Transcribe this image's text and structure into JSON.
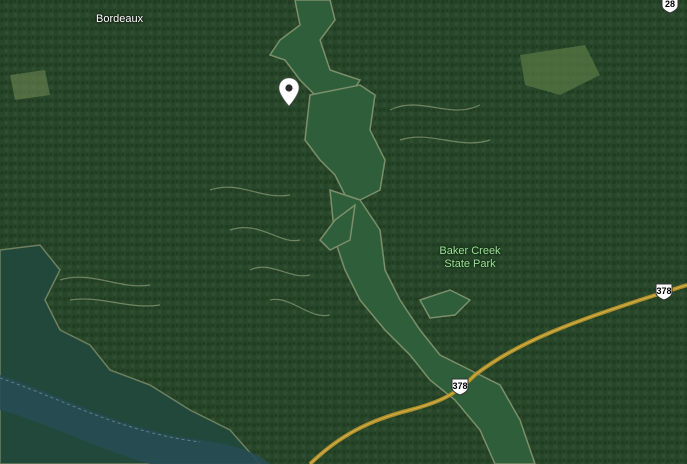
{
  "map": {
    "view": "satellite",
    "places": [
      {
        "id": "bordeaux",
        "label": "Bordeaux"
      }
    ],
    "parks": [
      {
        "id": "baker-creek",
        "line1": "Baker Creek",
        "line2": "State Park"
      }
    ],
    "route_shields": [
      {
        "id": "us-378-east",
        "number": "378"
      },
      {
        "id": "us-378-bridge",
        "number": "378"
      },
      {
        "id": "route-28",
        "number": "28"
      }
    ],
    "marker": {
      "icon": "location-pin-icon"
    },
    "colors": {
      "forest": "#26442a",
      "water": "#2f5e3a",
      "road": "#b08f2a",
      "park_label": "#9ee09a",
      "place_label": "#ffffff"
    }
  }
}
